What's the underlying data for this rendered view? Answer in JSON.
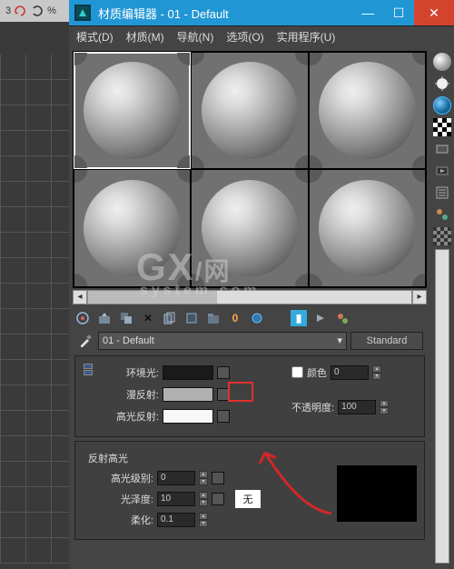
{
  "left": {
    "zoom_text": "3",
    "percent": "%"
  },
  "title": "材质编辑器 - 01 - Default",
  "menus": {
    "mode": "模式(D)",
    "material": "材质(M)",
    "navigate": "导航(N)",
    "options": "选项(O)",
    "utilities": "实用程序(U)"
  },
  "material_name": "01 - Default",
  "shader_type": "Standard",
  "params": {
    "ambient_label": "环境光:",
    "diffuse_label": "漫反射:",
    "specular_label": "高光反射:",
    "color_label": "颜色",
    "color_value": "0",
    "opacity_label": "不透明度:",
    "opacity_value": "100"
  },
  "highlight": {
    "section": "反射高光",
    "level_label": "高光级别:",
    "level_value": "0",
    "gloss_label": "光泽度:",
    "gloss_value": "10",
    "none": "无",
    "soften_label": "柔化:",
    "soften_value": "0.1"
  },
  "watermark": {
    "big": "GX",
    "tag": "/网",
    "sub": "system.com"
  }
}
